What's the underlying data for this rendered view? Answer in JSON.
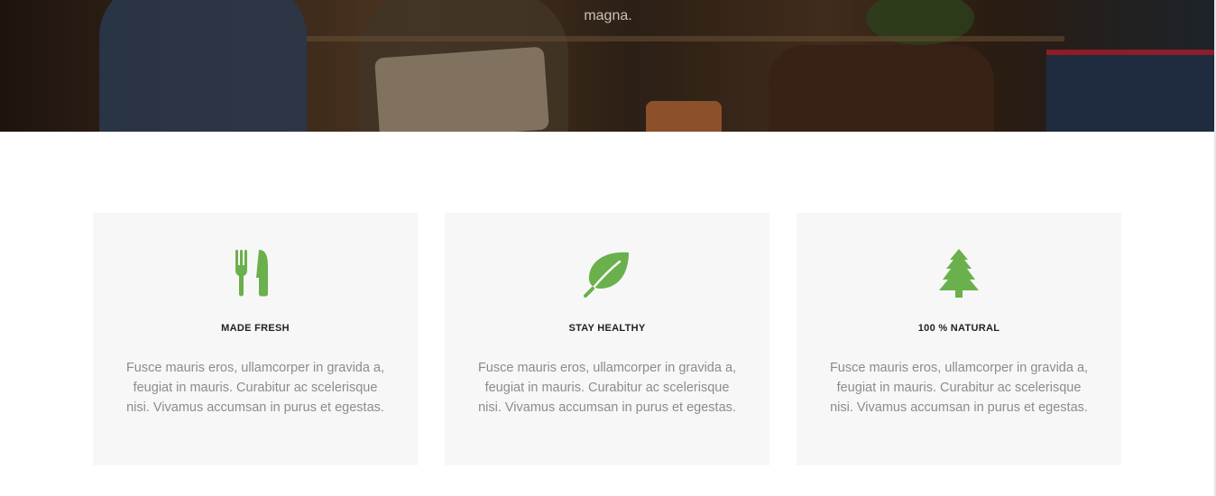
{
  "hero": {
    "text_fragment": "magna."
  },
  "features": [
    {
      "icon": "cutlery-icon",
      "title": "MADE FRESH",
      "description": "Fusce mauris eros, ullamcorper in gravida a, feugiat in mauris. Curabitur ac scelerisque nisi. Vivamus accumsan in purus et egestas."
    },
    {
      "icon": "leaf-icon",
      "title": "STAY HEALTHY",
      "description": "Fusce mauris eros, ullamcorper in gravida a, feugiat in mauris. Curabitur ac scelerisque nisi. Vivamus accumsan in purus et egestas."
    },
    {
      "icon": "tree-icon",
      "title": "100 % NATURAL",
      "description": "Fusce mauris eros, ullamcorper in gravida a, feugiat in mauris. Curabitur ac scelerisque nisi. Vivamus accumsan in purus et egestas."
    }
  ],
  "colors": {
    "accent": "#6ab04c",
    "card_bg": "#f7f7f7",
    "text_muted": "#8c8c8c",
    "title": "#222222"
  }
}
